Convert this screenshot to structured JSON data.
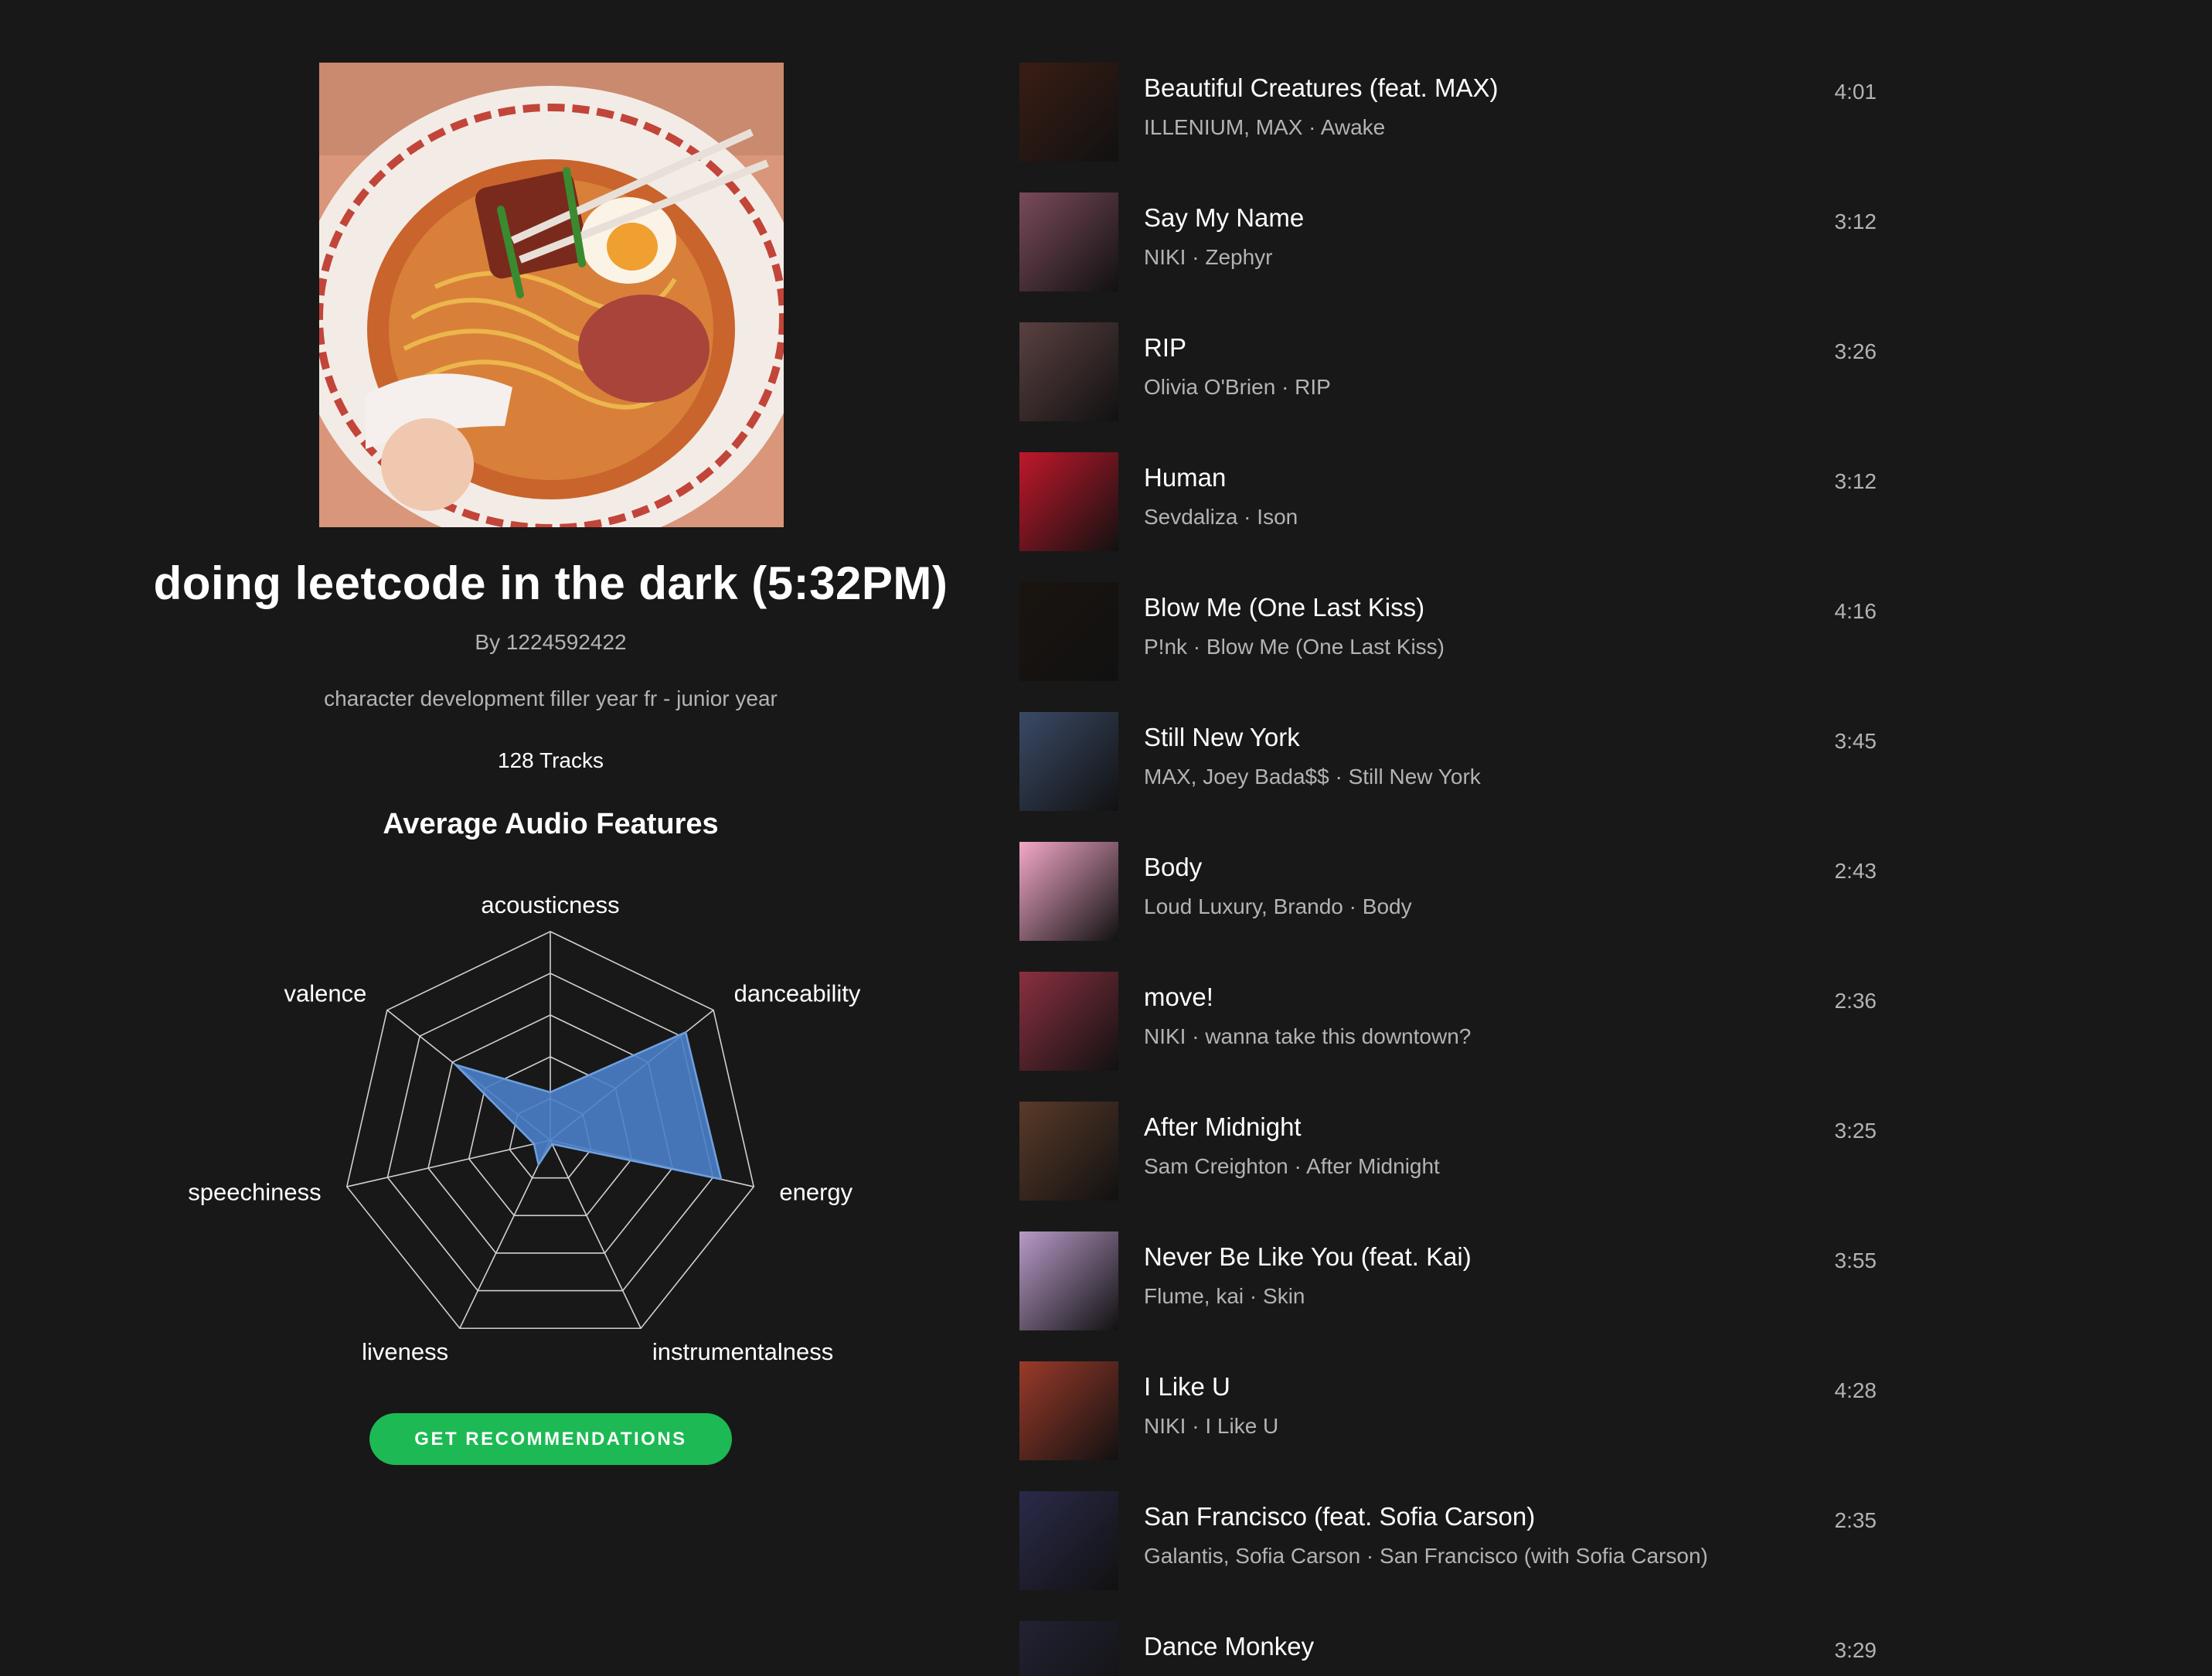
{
  "playlist": {
    "title": "doing leetcode in the dark (5:32PM)",
    "owner": "By 1224592422",
    "description": "character development filler year fr - junior year",
    "track_count": "128 Tracks",
    "cover_icon": "ramen-bowl-artwork"
  },
  "features": {
    "heading": "Average Audio Features",
    "chart_data": {
      "type": "radar",
      "axes": [
        "acousticness",
        "danceability",
        "energy",
        "instrumentalness",
        "liveness",
        "speechiness",
        "valence"
      ],
      "values": [
        0.23,
        0.83,
        0.84,
        0.02,
        0.13,
        0.08,
        0.58
      ],
      "range": [
        0,
        1
      ],
      "rings": 5,
      "fill_color": "#4a80c8",
      "stroke_color": "#6fa0e0"
    }
  },
  "actions": {
    "recommend_label": "GET RECOMMENDATIONS",
    "accent_color": "#1db954"
  },
  "tracks": [
    {
      "name": "Beautiful Creatures (feat. MAX)",
      "sub": "ILLENIUM, MAX · Awake",
      "duration": "4:01",
      "art": "#3a1d14"
    },
    {
      "name": "Say My Name",
      "sub": "NIKI · Zephyr",
      "duration": "3:12",
      "art": "#7a4a5a"
    },
    {
      "name": "RIP",
      "sub": "Olivia O'Brien · RIP",
      "duration": "3:26",
      "art": "#5a4040"
    },
    {
      "name": "Human",
      "sub": "Sevdaliza · Ison",
      "duration": "3:12",
      "art": "#c0182a"
    },
    {
      "name": "Blow Me (One Last Kiss)",
      "sub": "P!nk · Blow Me (One Last Kiss)",
      "duration": "4:16",
      "art": "#1a1410"
    },
    {
      "name": "Still New York",
      "sub": "MAX, Joey Bada$$ · Still New York",
      "duration": "3:45",
      "art": "#3a4a66"
    },
    {
      "name": "Body",
      "sub": "Loud Luxury, Brando · Body",
      "duration": "2:43",
      "art": "#f2a8c8"
    },
    {
      "name": "move!",
      "sub": "NIKI · wanna take this downtown?",
      "duration": "2:36",
      "art": "#8a3040"
    },
    {
      "name": "After Midnight",
      "sub": "Sam Creighton · After Midnight",
      "duration": "3:25",
      "art": "#5a3a2a"
    },
    {
      "name": "Never Be Like You (feat. Kai)",
      "sub": "Flume, kai · Skin",
      "duration": "3:55",
      "art": "#b89ac8"
    },
    {
      "name": "I Like U",
      "sub": "NIKI · I Like U",
      "duration": "4:28",
      "art": "#9a3a2a"
    },
    {
      "name": "San Francisco (feat. Sofia Carson)",
      "sub": "Galantis, Sofia Carson · San Francisco (with Sofia Carson)",
      "duration": "2:35",
      "art": "#2a2a4a"
    },
    {
      "name": "Dance Monkey",
      "sub": "",
      "duration": "3:29",
      "art": "#222233"
    }
  ]
}
